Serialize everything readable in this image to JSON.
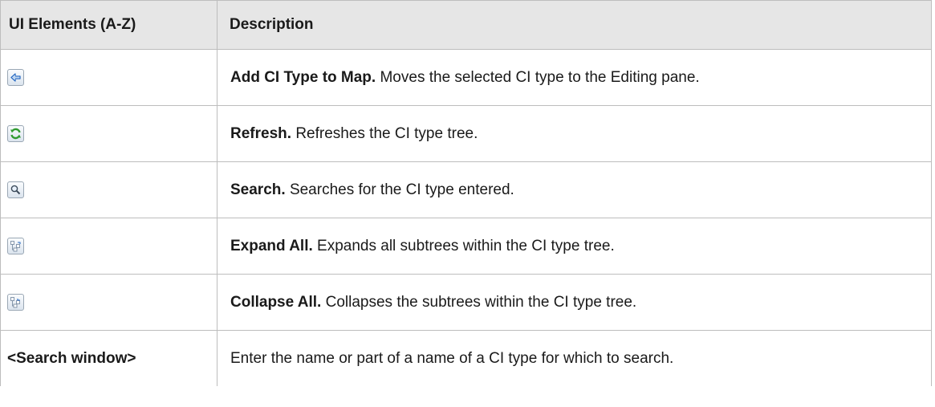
{
  "header": {
    "col_elements": "UI Elements (A-Z)",
    "col_description": "Description"
  },
  "rows": [
    {
      "icon": "add-ci-type-arrow-icon",
      "title": "Add CI Type to Map.",
      "text": "Moves the selected CI type to the Editing pane."
    },
    {
      "icon": "refresh-icon",
      "title": "Refresh.",
      "text": "Refreshes the CI type tree."
    },
    {
      "icon": "search-magnifier-icon",
      "title": "Search.",
      "text": "Searches for the CI type entered."
    },
    {
      "icon": "expand-all-icon",
      "title": "Expand All.",
      "text": "Expands all subtrees within the CI type tree."
    },
    {
      "icon": "collapse-all-icon",
      "title": "Collapse All.",
      "text": "Collapses the subtrees within the CI type tree."
    },
    {
      "element": "<Search window>",
      "text": "Enter the name or part of a name of a CI type for which to search."
    }
  ]
}
